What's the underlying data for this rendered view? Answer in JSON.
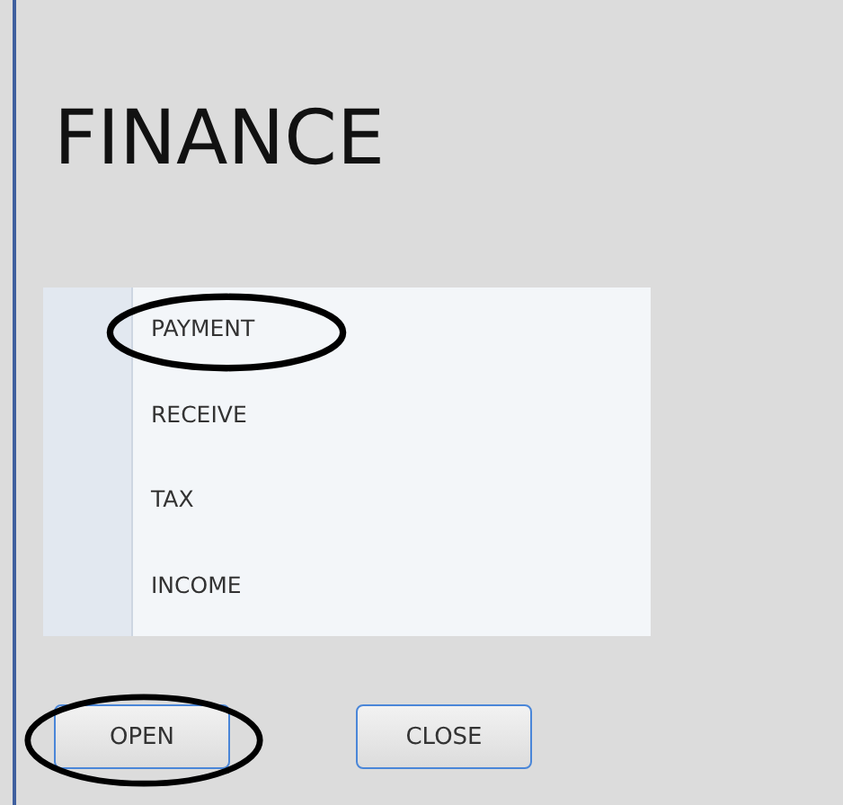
{
  "title": "FINANCE",
  "menu": [
    {
      "label": "PAYMENT",
      "circled": true
    },
    {
      "label": "RECEIVE",
      "circled": false
    },
    {
      "label": "TAX",
      "circled": false
    },
    {
      "label": "INCOME",
      "circled": false
    }
  ],
  "buttons": [
    {
      "label": "OPEN",
      "circled": true
    },
    {
      "label": "CLOSE",
      "circled": false
    }
  ]
}
